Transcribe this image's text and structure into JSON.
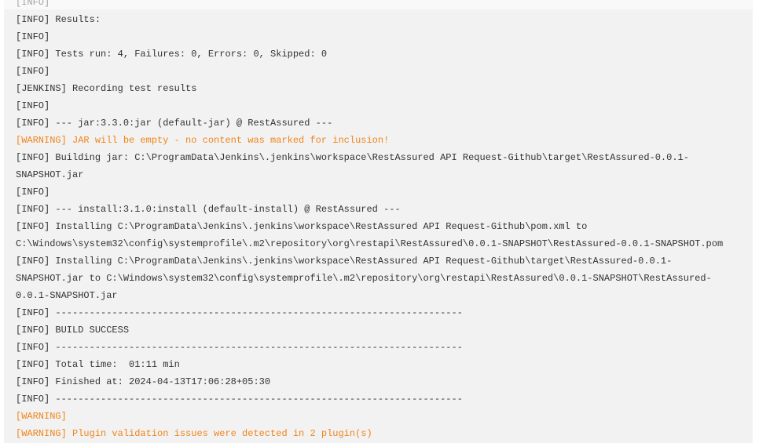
{
  "colors": {
    "text": "#333333",
    "warning": "#f0841a",
    "background": "#f2f2f2"
  },
  "lines": [
    {
      "text": "[INFO]",
      "type": "info"
    },
    {
      "text": "[INFO] Results:",
      "type": "info"
    },
    {
      "text": "[INFO]",
      "type": "info"
    },
    {
      "text": "[INFO] Tests run: 4, Failures: 0, Errors: 0, Skipped: 0",
      "type": "info"
    },
    {
      "text": "[INFO]",
      "type": "info"
    },
    {
      "text": "[JENKINS] Recording test results",
      "type": "info"
    },
    {
      "text": "[INFO]",
      "type": "info"
    },
    {
      "text": "[INFO] --- jar:3.3.0:jar (default-jar) @ RestAssured ---",
      "type": "info"
    },
    {
      "text": "[WARNING] JAR will be empty - no content was marked for inclusion!",
      "type": "warn"
    },
    {
      "text": "[INFO] Building jar: C:\\ProgramData\\Jenkins\\.jenkins\\workspace\\RestAssured API Request-Github\\target\\RestAssured-0.0.1-",
      "type": "info"
    },
    {
      "text": "SNAPSHOT.jar",
      "type": "info"
    },
    {
      "text": "[INFO]",
      "type": "info"
    },
    {
      "text": "[INFO] --- install:3.1.0:install (default-install) @ RestAssured ---",
      "type": "info"
    },
    {
      "text": "[INFO] Installing C:\\ProgramData\\Jenkins\\.jenkins\\workspace\\RestAssured API Request-Github\\pom.xml to",
      "type": "info"
    },
    {
      "text": "C:\\Windows\\system32\\config\\systemprofile\\.m2\\repository\\org\\restapi\\RestAssured\\0.0.1-SNAPSHOT\\RestAssured-0.0.1-SNAPSHOT.pom",
      "type": "info"
    },
    {
      "text": "[INFO] Installing C:\\ProgramData\\Jenkins\\.jenkins\\workspace\\RestAssured API Request-Github\\target\\RestAssured-0.0.1-",
      "type": "info"
    },
    {
      "text": "SNAPSHOT.jar to C:\\Windows\\system32\\config\\systemprofile\\.m2\\repository\\org\\restapi\\RestAssured\\0.0.1-SNAPSHOT\\RestAssured-",
      "type": "info"
    },
    {
      "text": "0.0.1-SNAPSHOT.jar",
      "type": "info"
    },
    {
      "text": "[INFO] ------------------------------------------------------------------------",
      "type": "info"
    },
    {
      "text": "[INFO] BUILD SUCCESS",
      "type": "info"
    },
    {
      "text": "[INFO] ------------------------------------------------------------------------",
      "type": "info"
    },
    {
      "text": "[INFO] Total time:  01:11 min",
      "type": "info"
    },
    {
      "text": "[INFO] Finished at: 2024-04-13T17:06:28+05:30",
      "type": "info"
    },
    {
      "text": "[INFO] ------------------------------------------------------------------------",
      "type": "info"
    },
    {
      "text": "[WARNING]",
      "type": "warn"
    },
    {
      "text": "[WARNING] Plugin validation issues were detected in 2 plugin(s)",
      "type": "warn"
    }
  ]
}
